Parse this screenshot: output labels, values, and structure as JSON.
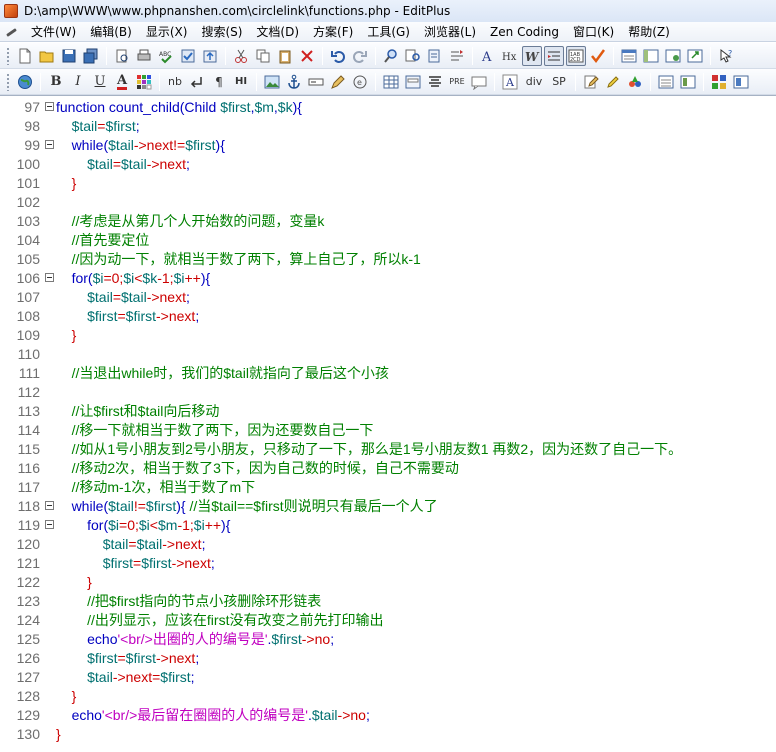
{
  "window": {
    "title": "D:\\amp\\WWW\\www.phpnanshen.com\\circlelink\\functions.php - EditPlus"
  },
  "menu": {
    "items": [
      "文件(W)",
      "编辑(B)",
      "显示(X)",
      "搜索(S)",
      "文档(D)",
      "方案(F)",
      "工具(G)",
      "浏览器(L)",
      "Zen Coding",
      "窗口(K)",
      "帮助(Z)"
    ]
  },
  "toolbar2_labels": {
    "bold": "B",
    "italic": "I",
    "underline": "U",
    "font_color": "A",
    "nbsp": "nb",
    "paragraph": "¶",
    "hr": "HI",
    "pre": "PRE",
    "div": "div",
    "span": "SP",
    "heading_a": "A",
    "heading_hx": "Hx"
  },
  "colors": {
    "keyword": "#0000c0",
    "variable": "#007070",
    "operator": "#cc0000",
    "comment": "#008000",
    "string": "#c000c0"
  },
  "editor": {
    "lines": [
      {
        "n": "97",
        "fold": true,
        "tokens": [
          [
            "kw",
            "function count_child(Child "
          ],
          [
            "var",
            "$first"
          ],
          [
            "kw",
            ","
          ],
          [
            "var",
            "$m"
          ],
          [
            "kw",
            ","
          ],
          [
            "var",
            "$k"
          ],
          [
            "kw",
            "){"
          ]
        ]
      },
      {
        "n": "98",
        "fold": false,
        "tokens": [
          [
            "txt",
            "    "
          ],
          [
            "var",
            "$tail"
          ],
          [
            "op",
            "="
          ],
          [
            "var",
            "$first"
          ],
          [
            "kw",
            ";"
          ]
        ]
      },
      {
        "n": "99",
        "fold": true,
        "tokens": [
          [
            "txt",
            "    "
          ],
          [
            "kw",
            "while("
          ],
          [
            "var",
            "$tail"
          ],
          [
            "op",
            "->next!="
          ],
          [
            "var",
            "$first"
          ],
          [
            "kw",
            "){"
          ]
        ]
      },
      {
        "n": "100",
        "fold": false,
        "tokens": [
          [
            "txt",
            "        "
          ],
          [
            "var",
            "$tail"
          ],
          [
            "op",
            "="
          ],
          [
            "var",
            "$tail"
          ],
          [
            "op",
            "->next"
          ],
          [
            "kw",
            ";"
          ]
        ]
      },
      {
        "n": "101",
        "fold": false,
        "tokens": [
          [
            "txt",
            "    "
          ],
          [
            "op",
            "}"
          ]
        ]
      },
      {
        "n": "102",
        "fold": false,
        "tokens": []
      },
      {
        "n": "103",
        "fold": false,
        "tokens": [
          [
            "txt",
            "    "
          ],
          [
            "cm",
            "//考虑是从第几个人开始数的问题，变量k"
          ]
        ]
      },
      {
        "n": "104",
        "fold": false,
        "tokens": [
          [
            "txt",
            "    "
          ],
          [
            "cm",
            "//首先要定位"
          ]
        ]
      },
      {
        "n": "105",
        "fold": false,
        "tokens": [
          [
            "txt",
            "    "
          ],
          [
            "cm",
            "//因为动一下，就相当于数了两下，算上自己了，所以k-1"
          ]
        ]
      },
      {
        "n": "106",
        "fold": true,
        "tokens": [
          [
            "txt",
            "    "
          ],
          [
            "kw",
            "for("
          ],
          [
            "var",
            "$i"
          ],
          [
            "op",
            "=0;"
          ],
          [
            "var",
            "$i"
          ],
          [
            "op",
            "<"
          ],
          [
            "var",
            "$k"
          ],
          [
            "op",
            "-1;"
          ],
          [
            "var",
            "$i"
          ],
          [
            "op",
            "++"
          ],
          [
            "kw",
            "){"
          ]
        ]
      },
      {
        "n": "107",
        "fold": false,
        "tokens": [
          [
            "txt",
            "        "
          ],
          [
            "var",
            "$tail"
          ],
          [
            "op",
            "="
          ],
          [
            "var",
            "$tail"
          ],
          [
            "op",
            "->next"
          ],
          [
            "kw",
            ";"
          ]
        ]
      },
      {
        "n": "108",
        "fold": false,
        "tokens": [
          [
            "txt",
            "        "
          ],
          [
            "var",
            "$first"
          ],
          [
            "op",
            "="
          ],
          [
            "var",
            "$first"
          ],
          [
            "op",
            "->next"
          ],
          [
            "kw",
            ";"
          ]
        ]
      },
      {
        "n": "109",
        "fold": false,
        "tokens": [
          [
            "txt",
            "    "
          ],
          [
            "op",
            "}"
          ]
        ]
      },
      {
        "n": "110",
        "fold": false,
        "tokens": []
      },
      {
        "n": "111",
        "fold": false,
        "tokens": [
          [
            "txt",
            "    "
          ],
          [
            "cm",
            "//当退出while时，我们的$tail就指向了最后这个小孩"
          ]
        ]
      },
      {
        "n": "112",
        "fold": false,
        "tokens": []
      },
      {
        "n": "113",
        "fold": false,
        "tokens": [
          [
            "txt",
            "    "
          ],
          [
            "cm",
            "//让$first和$tail向后移动"
          ]
        ]
      },
      {
        "n": "114",
        "fold": false,
        "tokens": [
          [
            "txt",
            "    "
          ],
          [
            "cm",
            "//移一下就相当于数了两下，因为还要数自己一下"
          ]
        ]
      },
      {
        "n": "115",
        "fold": false,
        "tokens": [
          [
            "txt",
            "    "
          ],
          [
            "cm",
            "//如从1号小朋友到2号小朋友，只移动了一下，那么是1号小朋友数1 再数2，因为还数了自己一下。"
          ]
        ]
      },
      {
        "n": "116",
        "fold": false,
        "tokens": [
          [
            "txt",
            "    "
          ],
          [
            "cm",
            "//移动2次，相当于数了3下，因为自己数的时候，自己不需要动"
          ]
        ]
      },
      {
        "n": "117",
        "fold": false,
        "tokens": [
          [
            "txt",
            "    "
          ],
          [
            "cm",
            "//移动m-1次，相当于数了m下"
          ]
        ]
      },
      {
        "n": "118",
        "fold": true,
        "tokens": [
          [
            "txt",
            "    "
          ],
          [
            "kw",
            "while("
          ],
          [
            "var",
            "$tail"
          ],
          [
            "op",
            "!="
          ],
          [
            "var",
            "$first"
          ],
          [
            "kw",
            "){ "
          ],
          [
            "cm",
            "//当$tail==$first则说明只有最后一个人了"
          ]
        ]
      },
      {
        "n": "119",
        "fold": true,
        "tokens": [
          [
            "txt",
            "        "
          ],
          [
            "kw",
            "for("
          ],
          [
            "var",
            "$i"
          ],
          [
            "op",
            "=0;"
          ],
          [
            "var",
            "$i"
          ],
          [
            "op",
            "<"
          ],
          [
            "var",
            "$m"
          ],
          [
            "op",
            "-1;"
          ],
          [
            "var",
            "$i"
          ],
          [
            "op",
            "++"
          ],
          [
            "kw",
            "){"
          ]
        ]
      },
      {
        "n": "120",
        "fold": false,
        "tokens": [
          [
            "txt",
            "            "
          ],
          [
            "var",
            "$tail"
          ],
          [
            "op",
            "="
          ],
          [
            "var",
            "$tail"
          ],
          [
            "op",
            "->next"
          ],
          [
            "kw",
            ";"
          ]
        ]
      },
      {
        "n": "121",
        "fold": false,
        "tokens": [
          [
            "txt",
            "            "
          ],
          [
            "var",
            "$first"
          ],
          [
            "op",
            "="
          ],
          [
            "var",
            "$first"
          ],
          [
            "op",
            "->next"
          ],
          [
            "kw",
            ";"
          ]
        ]
      },
      {
        "n": "122",
        "fold": false,
        "tokens": [
          [
            "txt",
            "        "
          ],
          [
            "op",
            "}"
          ]
        ]
      },
      {
        "n": "123",
        "fold": false,
        "tokens": [
          [
            "txt",
            "        "
          ],
          [
            "cm",
            "//把$first指向的节点小孩删除环形链表"
          ]
        ]
      },
      {
        "n": "124",
        "fold": false,
        "tokens": [
          [
            "txt",
            "        "
          ],
          [
            "cm",
            "//出列显示，应该在first没有改变之前先打印输出"
          ]
        ]
      },
      {
        "n": "125",
        "fold": false,
        "tokens": [
          [
            "txt",
            "        "
          ],
          [
            "kw",
            "echo"
          ],
          [
            "str",
            "'<br/>出圈的人的编号是'"
          ],
          [
            "kw",
            "."
          ],
          [
            "var",
            "$first"
          ],
          [
            "op",
            "->no"
          ],
          [
            "kw",
            ";"
          ]
        ]
      },
      {
        "n": "126",
        "fold": false,
        "tokens": [
          [
            "txt",
            "        "
          ],
          [
            "var",
            "$first"
          ],
          [
            "op",
            "="
          ],
          [
            "var",
            "$first"
          ],
          [
            "op",
            "->next"
          ],
          [
            "kw",
            ";"
          ]
        ]
      },
      {
        "n": "127",
        "fold": false,
        "tokens": [
          [
            "txt",
            "        "
          ],
          [
            "var",
            "$tail"
          ],
          [
            "op",
            "->next="
          ],
          [
            "var",
            "$first"
          ],
          [
            "kw",
            ";"
          ]
        ]
      },
      {
        "n": "128",
        "fold": false,
        "tokens": [
          [
            "txt",
            "    "
          ],
          [
            "op",
            "}"
          ]
        ]
      },
      {
        "n": "129",
        "fold": false,
        "tokens": [
          [
            "txt",
            "    "
          ],
          [
            "kw",
            "echo"
          ],
          [
            "str",
            "'<br/>最后留在圈圈的人的编号是'"
          ],
          [
            "kw",
            "."
          ],
          [
            "var",
            "$tail"
          ],
          [
            "op",
            "->no"
          ],
          [
            "kw",
            ";"
          ]
        ]
      },
      {
        "n": "130",
        "fold": false,
        "tokens": [
          [
            "op",
            "}"
          ]
        ]
      }
    ]
  }
}
